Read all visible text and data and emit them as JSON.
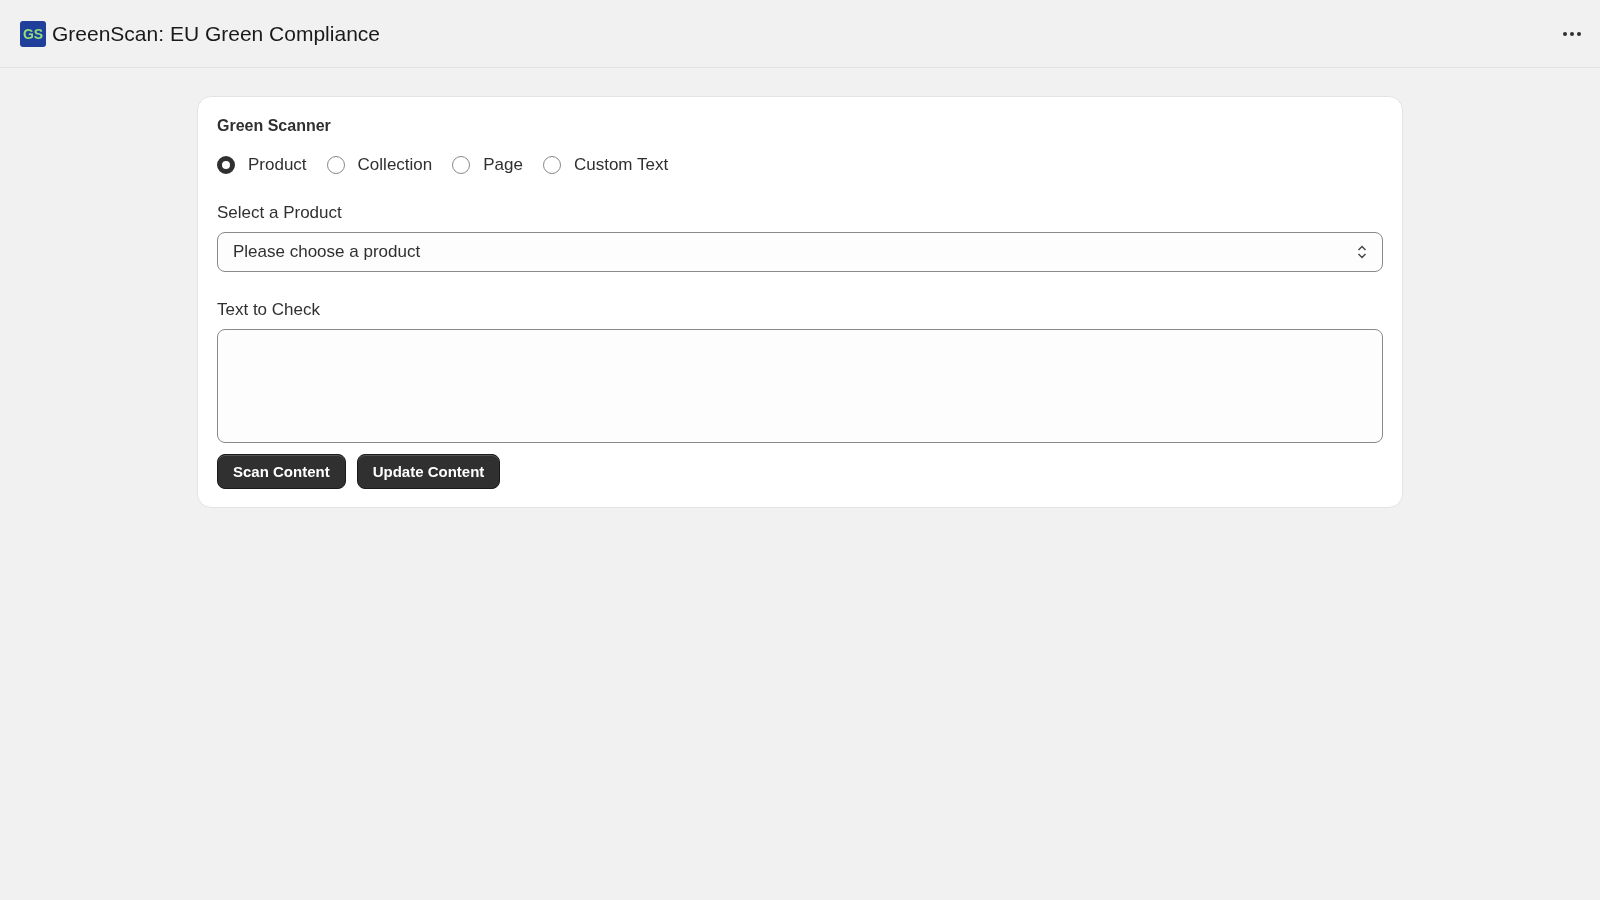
{
  "header": {
    "logo": "GS",
    "title": "GreenScan: EU Green Compliance"
  },
  "card": {
    "title": "Green Scanner",
    "radios": [
      {
        "label": "Product",
        "selected": true
      },
      {
        "label": "Collection",
        "selected": false
      },
      {
        "label": "Page",
        "selected": false
      },
      {
        "label": "Custom Text",
        "selected": false
      }
    ],
    "select": {
      "label": "Select a Product",
      "placeholder": "Please choose a product"
    },
    "textarea": {
      "label": "Text to Check"
    },
    "buttons": [
      "Scan Content",
      "Update Content"
    ]
  }
}
